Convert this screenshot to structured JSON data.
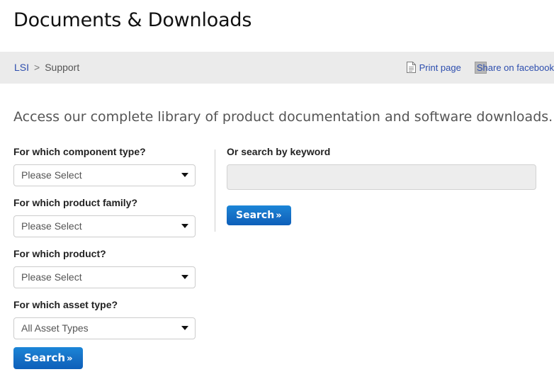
{
  "page": {
    "title": "Documents & Downloads",
    "intro": "Access our complete library of product documentation and software downloads."
  },
  "breadcrumb": {
    "home_label": "LSI",
    "separator": ">",
    "current_label": "Support"
  },
  "page_tools": {
    "print_label": "Print page",
    "print_icon": "document-page-icon",
    "share_label": "Share on facebook",
    "share_icon": "broken-image-icon"
  },
  "filters": {
    "fields": [
      {
        "label": "For which component type?",
        "value": "Please Select",
        "name": "component-type"
      },
      {
        "label": "For which product family?",
        "value": "Please Select",
        "name": "product-family"
      },
      {
        "label": "For which product?",
        "value": "Please Select",
        "name": "product"
      },
      {
        "label": "For which asset type?",
        "value": "All Asset Types",
        "name": "asset-type"
      }
    ],
    "submit_label": "Search",
    "submit_chevron": "»"
  },
  "keyword_search": {
    "label": "Or search by keyword",
    "value": "",
    "placeholder": "",
    "submit_label": "Search",
    "submit_chevron": "»"
  },
  "colors": {
    "link": "#2d4eae",
    "button_blue": "#1874c8",
    "breadcrumb_bar": "#ebebeb",
    "input_fill": "#ededed"
  }
}
